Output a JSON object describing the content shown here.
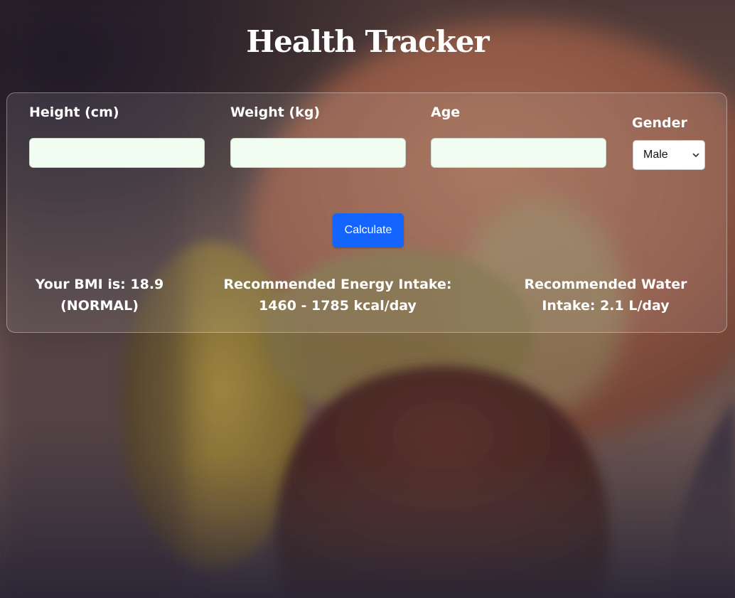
{
  "app": {
    "title": "Health Tracker"
  },
  "form": {
    "height": {
      "label": "Height (cm)",
      "value": ""
    },
    "weight": {
      "label": "Weight (kg)",
      "value": ""
    },
    "age": {
      "label": "Age",
      "value": ""
    },
    "gender": {
      "label": "Gender",
      "selected": "Male"
    },
    "calculate_label": "Calculate"
  },
  "results": {
    "bmi_text": "Your BMI is: 18.9",
    "bmi_category": "(NORMAL)",
    "energy_text": "Recommended Energy Intake:",
    "energy_value": "1460 - 1785 kcal/day",
    "water_text": "Recommended Water",
    "water_value": "Intake: 2.1 L/day"
  },
  "colors": {
    "button": "#1465ff",
    "input_background": "#f1fdf1",
    "text": "#ffffff"
  },
  "icons": {
    "gender_select": "chevron-down-icon"
  }
}
